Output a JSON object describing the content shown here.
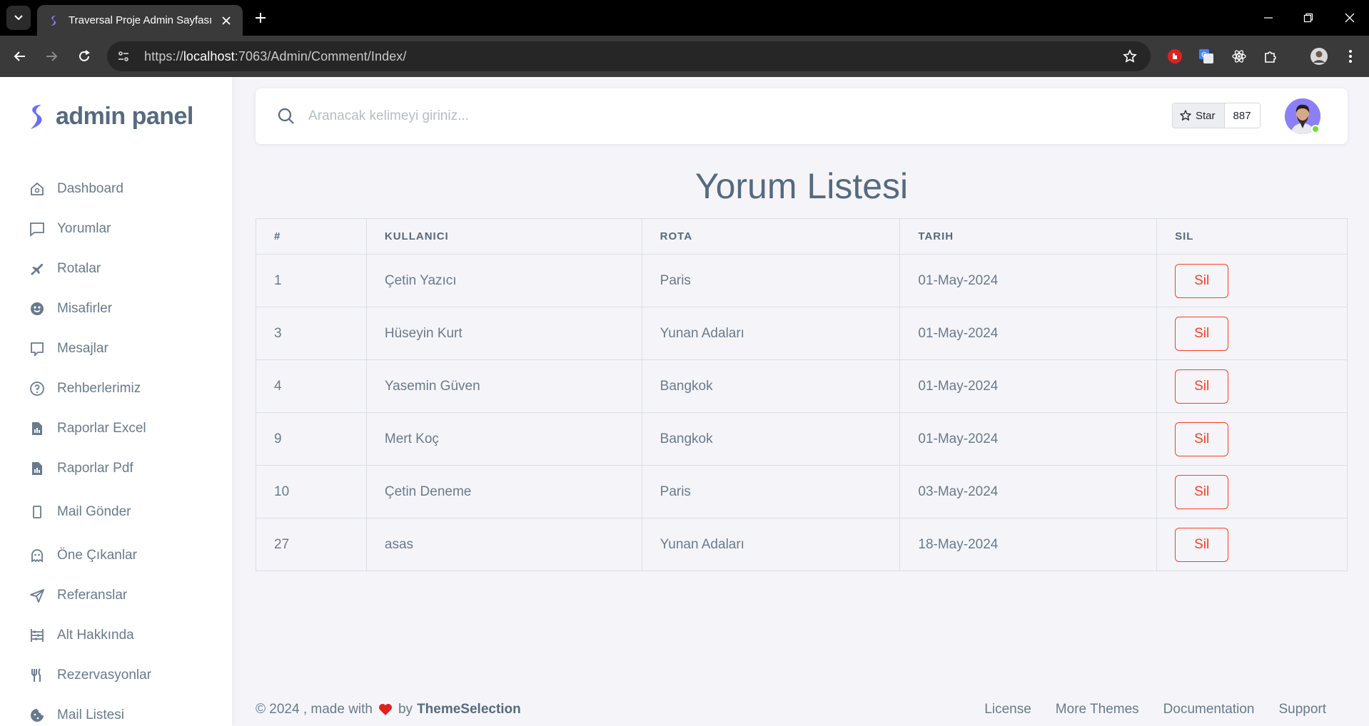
{
  "browser": {
    "tab_title": "Traversal Proje Admin Sayfası",
    "url_prefix": "https://",
    "url_host": "localhost",
    "url_rest": ":7063/Admin/Comment/Index/"
  },
  "sidebar": {
    "brand": "admin panel",
    "items": [
      {
        "label": "Dashboard",
        "icon": "home-icon"
      },
      {
        "label": "Yorumlar",
        "icon": "comment-icon"
      },
      {
        "label": "Rotalar",
        "icon": "plane-icon"
      },
      {
        "label": "Misafirler",
        "icon": "smiley-icon"
      },
      {
        "label": "Mesajlar",
        "icon": "message-icon"
      },
      {
        "label": "Rehberlerimiz",
        "icon": "help-circle-icon"
      },
      {
        "label": "Raporlar Excel",
        "icon": "report-icon"
      },
      {
        "label": "Raporlar Pdf",
        "icon": "report-icon"
      },
      {
        "label": "Mail Gönder",
        "icon": "mobile-icon"
      },
      {
        "label": "Öne Çıkanlar",
        "icon": "ghost-icon"
      },
      {
        "label": "Referanslar",
        "icon": "send-icon"
      },
      {
        "label": "Alt Hakkında",
        "icon": "abacus-icon"
      },
      {
        "label": "Rezervasyonlar",
        "icon": "restaurant-icon"
      },
      {
        "label": "Mail Listesi",
        "icon": "cookie-icon"
      }
    ]
  },
  "navbar": {
    "search_placeholder": "Aranacak kelimeyi giriniz...",
    "star_label": "Star",
    "star_count": "887"
  },
  "page": {
    "title": "Yorum Listesi"
  },
  "table": {
    "headers": [
      "#",
      "KULLANICI",
      "ROTA",
      "TARIH",
      "SIL"
    ],
    "rows": [
      {
        "id": "1",
        "user": "Çetin Yazıcı",
        "route": "Paris",
        "date": "01-May-2024",
        "action": "Sil"
      },
      {
        "id": "3",
        "user": "Hüseyin Kurt",
        "route": "Yunan Adaları",
        "date": "01-May-2024",
        "action": "Sil"
      },
      {
        "id": "4",
        "user": "Yasemin Güven",
        "route": "Bangkok",
        "date": "01-May-2024",
        "action": "Sil"
      },
      {
        "id": "9",
        "user": "Mert Koç",
        "route": "Bangkok",
        "date": "01-May-2024",
        "action": "Sil"
      },
      {
        "id": "10",
        "user": "Çetin Deneme",
        "route": "Paris",
        "date": "03-May-2024",
        "action": "Sil"
      },
      {
        "id": "27",
        "user": "asas",
        "route": "Yunan Adaları",
        "date": "18-May-2024",
        "action": "Sil"
      }
    ]
  },
  "footer": {
    "copyright": "© 2024 , made with",
    "by": "by",
    "brand": "ThemeSelection",
    "links": [
      "License",
      "More Themes",
      "Documentation",
      "Support"
    ]
  },
  "colors": {
    "accent": "#696cff",
    "danger": "#ff3e1d",
    "text": "#697a8d",
    "background": "#f5f5f9"
  }
}
